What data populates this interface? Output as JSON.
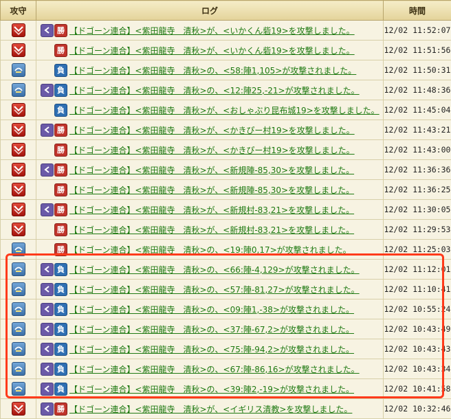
{
  "headers": {
    "col1": "攻守",
    "col2": "ログ",
    "col3": "時間"
  },
  "rows": [
    {
      "type": "attack",
      "purple": true,
      "result": "勝",
      "text": "【ドゴーン連合】<紫田龍寺　清秋>が、<いかくん砦19>を攻撃しました。",
      "time": "12/02 11:52:07"
    },
    {
      "type": "attack",
      "purple": false,
      "result": "勝",
      "text": "【ドゴーン連合】<紫田龍寺　清秋>が、<いかくん砦19>を攻撃しました。",
      "time": "12/02 11:51:56"
    },
    {
      "type": "defend",
      "purple": false,
      "result": "負",
      "text": "【ドゴーン連合】<紫田龍寺　清秋>の、<58:陣1,105>が攻撃されました。",
      "time": "12/02 11:50:31"
    },
    {
      "type": "defend",
      "purple": true,
      "result": "負",
      "text": "【ドゴーン連合】<紫田龍寺　清秋>の、<12:陣25,-21>が攻撃されました。",
      "time": "12/02 11:48:36"
    },
    {
      "type": "attack",
      "purple": false,
      "result": "負",
      "text": "【ドゴーン連合】<紫田龍寺　清秋>が、<おしゃぶり昆布城19>を攻撃しました。",
      "time": "12/02 11:45:04"
    },
    {
      "type": "attack",
      "purple": true,
      "result": "勝",
      "text": "【ドゴーン連合】<紫田龍寺　清秋>が、<かきぴー村19>を攻撃しました。",
      "time": "12/02 11:43:21"
    },
    {
      "type": "attack",
      "purple": false,
      "result": "勝",
      "text": "【ドゴーン連合】<紫田龍寺　清秋>が、<かきぴー村19>を攻撃しました。",
      "time": "12/02 11:43:00"
    },
    {
      "type": "attack",
      "purple": true,
      "result": "勝",
      "text": "【ドゴーン連合】<紫田龍寺　清秋>が、<新規陣-85,30>を攻撃しました。",
      "time": "12/02 11:36:36"
    },
    {
      "type": "attack",
      "purple": false,
      "result": "勝",
      "text": "【ドゴーン連合】<紫田龍寺　清秋>が、<新規陣-85,30>を攻撃しました。",
      "time": "12/02 11:36:25"
    },
    {
      "type": "attack",
      "purple": true,
      "result": "勝",
      "text": "【ドゴーン連合】<紫田龍寺　清秋>が、<新規村-83,21>を攻撃しました。",
      "time": "12/02 11:30:05"
    },
    {
      "type": "attack",
      "purple": false,
      "result": "勝",
      "text": "【ドゴーン連合】<紫田龍寺　清秋>が、<新規村-83,21>を攻撃しました。",
      "time": "12/02 11:29:53"
    },
    {
      "type": "defend",
      "purple": false,
      "result": "勝",
      "text": "【ドゴーン連合】<紫田龍寺　清秋>の、<19:陣0,17>が攻撃されました。",
      "time": "12/02 11:25:03"
    },
    {
      "type": "defend",
      "purple": true,
      "result": "負",
      "text": "【ドゴーン連合】<紫田龍寺　清秋>の、<66:陣-4,129>が攻撃されました。",
      "time": "12/02 11:12:01"
    },
    {
      "type": "defend",
      "purple": true,
      "result": "負",
      "text": "【ドゴーン連合】<紫田龍寺　清秋>の、<57:陣-81,27>が攻撃されました。",
      "time": "12/02 11:10:41"
    },
    {
      "type": "defend",
      "purple": true,
      "result": "負",
      "text": "【ドゴーン連合】<紫田龍寺　清秋>の、<09:陣1,-38>が攻撃されました。",
      "time": "12/02 10:55:24"
    },
    {
      "type": "defend",
      "purple": true,
      "result": "負",
      "text": "【ドゴーン連合】<紫田龍寺　清秋>の、<37:陣-67,2>が攻撃されました。",
      "time": "12/02 10:43:49"
    },
    {
      "type": "defend",
      "purple": true,
      "result": "負",
      "text": "【ドゴーン連合】<紫田龍寺　清秋>の、<75:陣-94,2>が攻撃されました。",
      "time": "12/02 10:43:43"
    },
    {
      "type": "defend",
      "purple": true,
      "result": "負",
      "text": "【ドゴーン連合】<紫田龍寺　清秋>の、<67:陣-86,16>が攻撃されました。",
      "time": "12/02 10:43:34"
    },
    {
      "type": "defend",
      "purple": true,
      "result": "負",
      "text": "【ドゴーン連合】<紫田龍寺　清秋>の、<39:陣2,-19>が攻撃されました。",
      "time": "12/02 10:41:58"
    },
    {
      "type": "attack",
      "purple": true,
      "result": "勝",
      "text": "【ドゴーン連合】<紫田龍寺　清秋>が、<イギリス清教>を攻撃しました。",
      "time": "12/02 10:32:46"
    }
  ],
  "colors": {
    "highlight": "#ff3a1a",
    "link": "#1f7a12",
    "win": "#c0342b",
    "lose": "#2f6fb2",
    "purple": "#6b5aa8"
  },
  "icons": {
    "attack": "crossed-swords-icon",
    "defend": "shield-defense-icon",
    "purple": "arrow-badge-icon"
  }
}
